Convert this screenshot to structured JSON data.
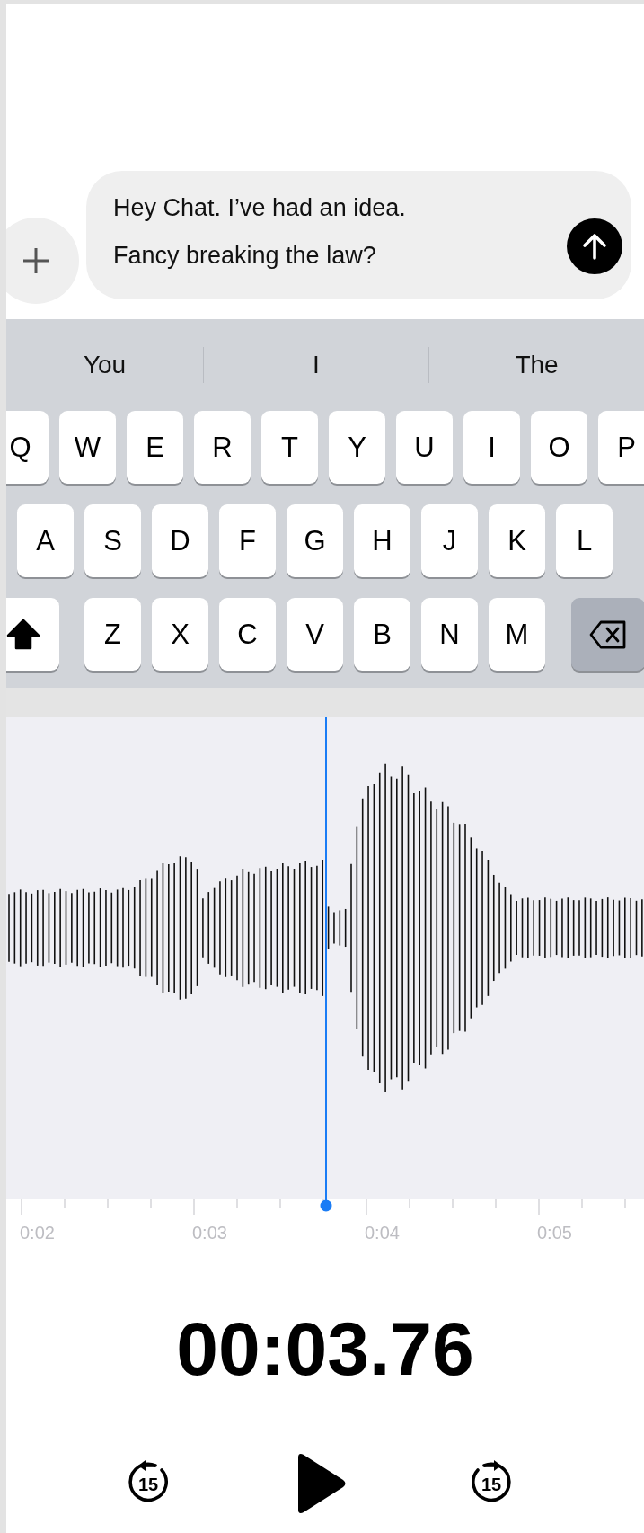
{
  "composer": {
    "message_lines": [
      "Hey Chat. I’ve had an idea.",
      "Fancy breaking the law?"
    ]
  },
  "keyboard": {
    "suggestions": [
      "You",
      "I",
      "The"
    ],
    "rows": [
      [
        {
          "kind": "letter",
          "label": "Q"
        },
        {
          "kind": "letter",
          "label": "W"
        },
        {
          "kind": "letter",
          "label": "E"
        },
        {
          "kind": "letter",
          "label": "R"
        },
        {
          "kind": "letter",
          "label": "T"
        },
        {
          "kind": "letter",
          "label": "Y"
        },
        {
          "kind": "letter",
          "label": "U"
        },
        {
          "kind": "letter",
          "label": "I"
        },
        {
          "kind": "letter",
          "label": "O"
        },
        {
          "kind": "letter",
          "label": "P"
        }
      ],
      [
        {
          "kind": "letter",
          "label": "A"
        },
        {
          "kind": "letter",
          "label": "S"
        },
        {
          "kind": "letter",
          "label": "D"
        },
        {
          "kind": "letter",
          "label": "F"
        },
        {
          "kind": "letter",
          "label": "G"
        },
        {
          "kind": "letter",
          "label": "H"
        },
        {
          "kind": "letter",
          "label": "J"
        },
        {
          "kind": "letter",
          "label": "K"
        },
        {
          "kind": "letter",
          "label": "L"
        }
      ],
      [
        {
          "kind": "shift",
          "on": true
        },
        {
          "kind": "letter",
          "label": "Z"
        },
        {
          "kind": "letter",
          "label": "X"
        },
        {
          "kind": "letter",
          "label": "C"
        },
        {
          "kind": "letter",
          "label": "V"
        },
        {
          "kind": "letter",
          "label": "B"
        },
        {
          "kind": "letter",
          "label": "N"
        },
        {
          "kind": "letter",
          "label": "M"
        },
        {
          "kind": "delete"
        }
      ]
    ]
  },
  "recording": {
    "ruler_labels": [
      "0:02",
      "0:03",
      "0:04",
      "0:05"
    ],
    "elapsed": "00:03.76",
    "skip_back": "15",
    "skip_forward": "15"
  }
}
